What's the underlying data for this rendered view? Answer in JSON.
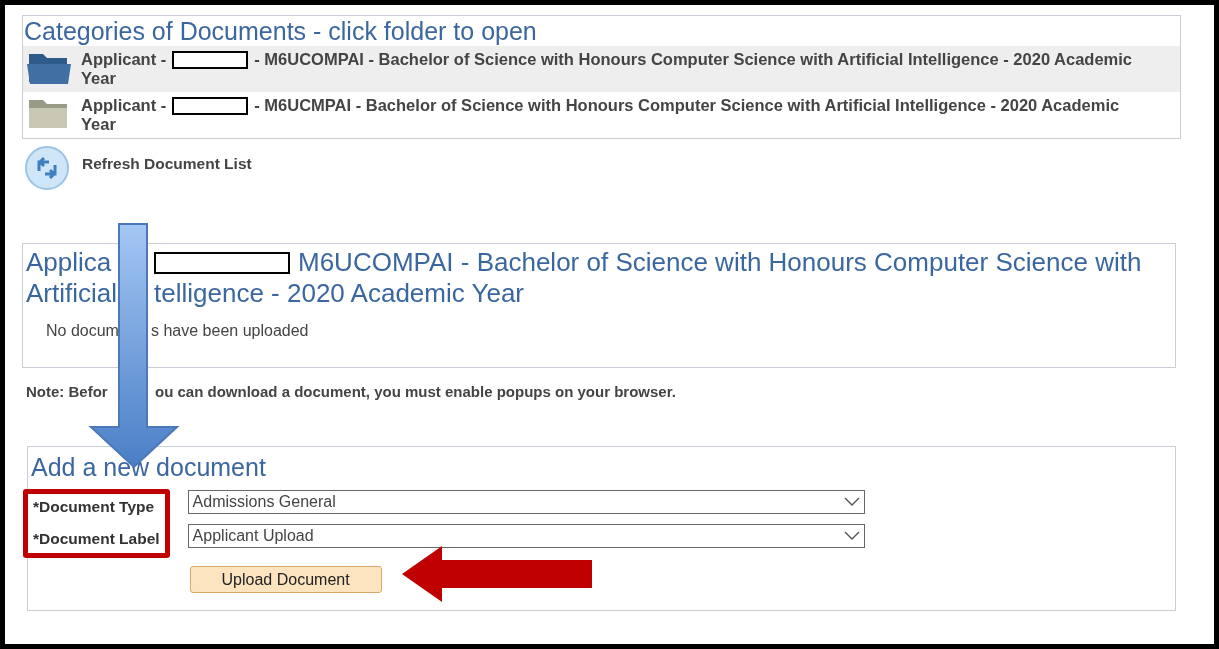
{
  "categories": {
    "title": "Categories of Documents - click folder to open",
    "folders": [
      {
        "prefix": "Applicant -",
        "suffix": "- M6UCOMPAI - Bachelor of Science with Honours Computer Science with Artificial Intelligence - 2020 Academic",
        "continuation": "Year",
        "selected": true
      },
      {
        "prefix": "Applicant -",
        "suffix": "- M6UCMPAI - Bachelor of Science with Honours Computer Science with Artificial Intelligence - 2020 Academic",
        "continuation": "Year",
        "selected": false
      }
    ]
  },
  "refresh": {
    "label": "Refresh Document List"
  },
  "documents": {
    "title_lines": [
      {
        "fragments": [
          "Applica",
          "M6UCOMPAI - Bachelor of Science with Honours Computer Science with"
        ],
        "redacted": true
      },
      {
        "fragments": [
          "Artificial",
          "telligence - 2020 Academic Year"
        ],
        "redacted": false
      }
    ],
    "empty_message": [
      "No docum",
      "s have been uploaded"
    ]
  },
  "note": [
    "Note: Befor",
    "ou can download a document, you must enable popups on your browser."
  ],
  "add_document": {
    "title": "Add a new document",
    "fields": [
      {
        "label": "*Document Type",
        "value": "Admissions General"
      },
      {
        "label": "*Document Label",
        "value": "Applicant Upload"
      }
    ],
    "button": "Upload Document"
  }
}
